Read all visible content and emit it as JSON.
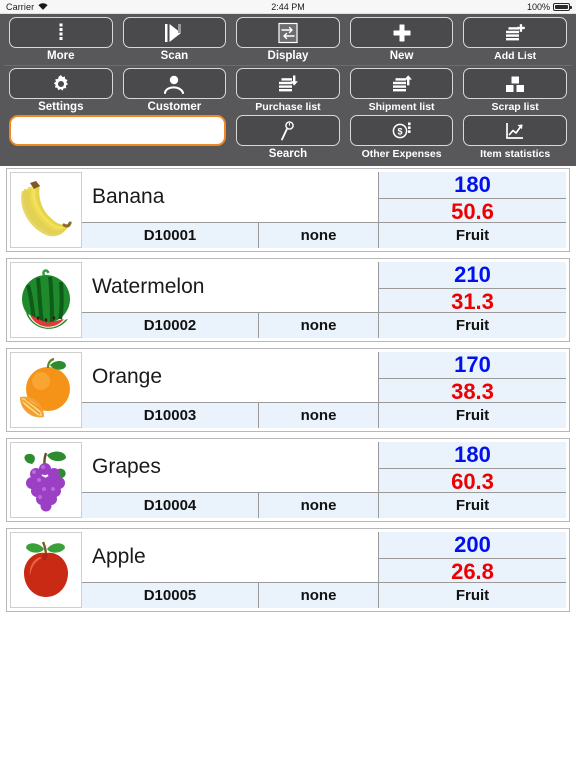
{
  "status_bar": {
    "carrier": "Carrier",
    "wifi_icon": "wifi-icon",
    "time": "2:44 PM",
    "battery_percent": "100%",
    "battery_icon": "battery-full-icon"
  },
  "toolbar": {
    "rows": [
      [
        {
          "label": "More",
          "icon": "more-dots-icon"
        },
        {
          "label": "Scan",
          "icon": "scan-play-icon"
        },
        {
          "label": "Display",
          "icon": "swap-arrows-icon"
        },
        {
          "label": "New",
          "icon": "plus-icon"
        },
        {
          "label": "Add List",
          "icon": "list-plus-icon"
        }
      ],
      [
        {
          "label": "Settings",
          "icon": "gear-icon"
        },
        {
          "label": "Customer",
          "icon": "person-icon"
        },
        {
          "label": "Purchase list",
          "icon": "list-down-arrow-icon"
        },
        {
          "label": "Shipment list",
          "icon": "list-up-arrow-icon"
        },
        {
          "label": "Scrap list",
          "icon": "boxes-icon"
        }
      ],
      [
        {
          "label": "Search",
          "icon": "magnifier-icon"
        },
        {
          "label": "Other Expenses",
          "icon": "dollar-coin-icon"
        },
        {
          "label": "Item statistics",
          "icon": "chart-up-icon"
        }
      ]
    ],
    "search_field": {
      "value": "",
      "placeholder": ""
    }
  },
  "list": {
    "columns": [
      "image",
      "name",
      "stock",
      "price",
      "code",
      "group",
      "category"
    ],
    "items": [
      {
        "name": "Banana",
        "stock": "180",
        "price": "50.6",
        "code": "D10001",
        "group": "none",
        "category": "Fruit",
        "image_icon": "banana-image"
      },
      {
        "name": "Watermelon",
        "stock": "210",
        "price": "31.3",
        "code": "D10002",
        "group": "none",
        "category": "Fruit",
        "image_icon": "watermelon-image"
      },
      {
        "name": "Orange",
        "stock": "170",
        "price": "38.3",
        "code": "D10003",
        "group": "none",
        "category": "Fruit",
        "image_icon": "orange-image"
      },
      {
        "name": "Grapes",
        "stock": "180",
        "price": "60.3",
        "code": "D10004",
        "group": "none",
        "category": "Fruit",
        "image_icon": "grapes-image"
      },
      {
        "name": "Apple",
        "stock": "200",
        "price": "26.8",
        "code": "D10005",
        "group": "none",
        "category": "Fruit",
        "image_icon": "apple-image"
      }
    ]
  },
  "colors": {
    "toolbar_bg": "#58585a",
    "button_border": "#d8d8d8",
    "search_border": "#ee8822",
    "stock_text": "#0011ee",
    "price_text": "#ee0000",
    "cell_bg": "#eaf2fb"
  }
}
